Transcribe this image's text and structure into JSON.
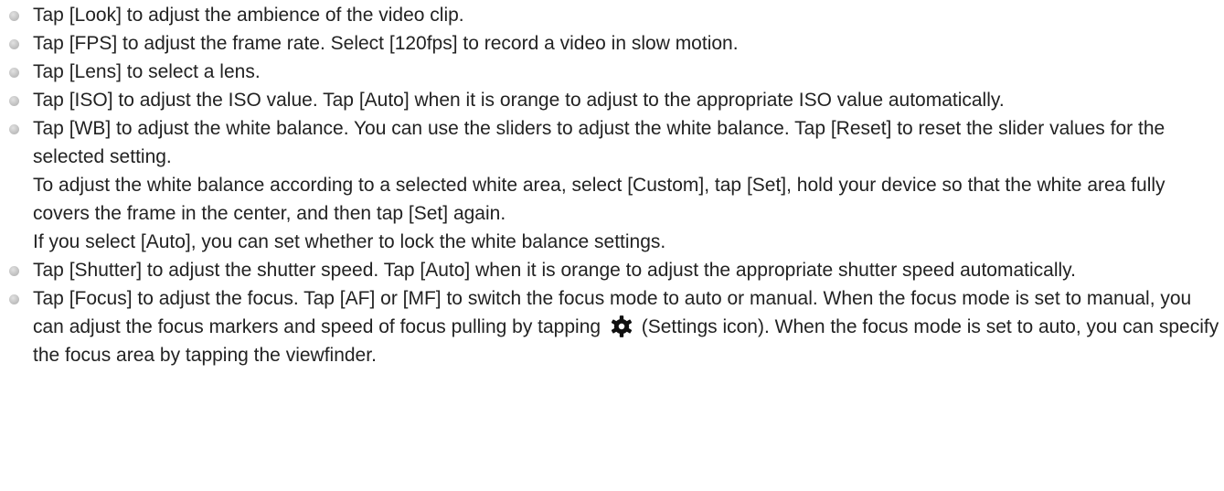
{
  "bullets": [
    {
      "text": "Tap [Look] to adjust the ambience of the video clip."
    },
    {
      "text": "Tap [FPS] to adjust the frame rate. Select [120fps] to record a video in slow motion."
    },
    {
      "text": "Tap [Lens] to select a lens."
    },
    {
      "text": "Tap [ISO] to adjust the ISO value. Tap [Auto] when it is orange to adjust to the appropriate ISO value automatically."
    },
    {
      "text": "Tap [WB] to adjust the white balance. You can use the sliders to adjust the white balance. Tap [Reset] to reset the slider values for the selected setting.",
      "extra1": "To adjust the white balance according to a selected white area, select [Custom], tap [Set], hold your device so that the white area fully covers the frame in the center, and then tap [Set] again.",
      "extra2": "If you select [Auto], you can set whether to lock the white balance settings."
    },
    {
      "text": "Tap [Shutter] to adjust the shutter speed. Tap [Auto] when it is orange to adjust the appropriate shutter speed automatically."
    },
    {
      "text_before": "Tap [Focus] to adjust the focus. Tap [AF] or [MF] to switch the focus mode to auto or manual. When the focus mode is set to manual, you can adjust the focus markers and speed of focus pulling by tapping",
      "icon": "gear-icon",
      "text_after": "(Settings icon). When the focus mode is set to auto, you can specify the focus area by tapping the viewfinder."
    }
  ]
}
